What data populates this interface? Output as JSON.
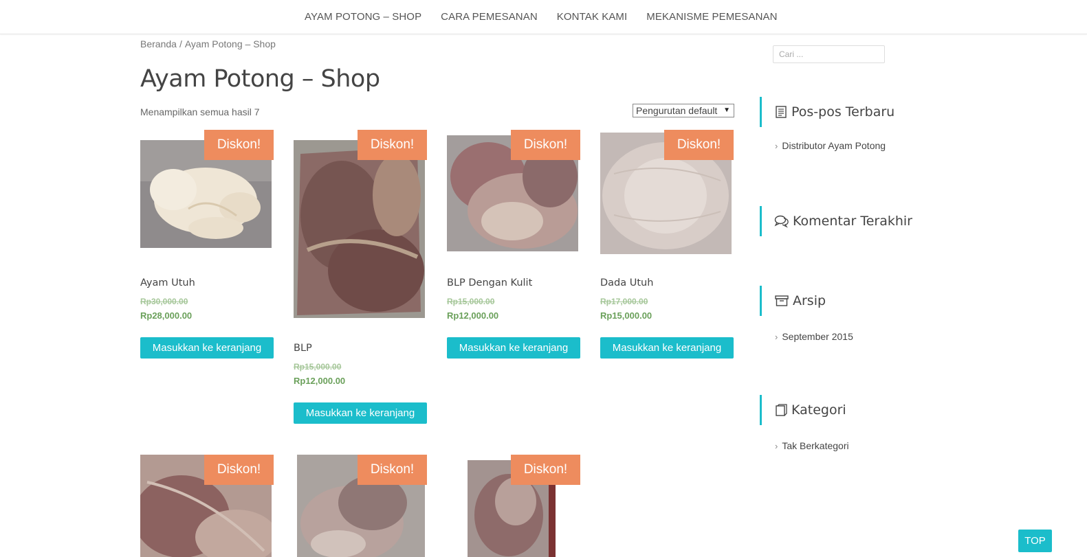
{
  "nav": [
    "AYAM POTONG – SHOP",
    "CARA PEMESANAN",
    "KONTAK KAMI",
    "MEKANISME PEMESANAN"
  ],
  "breadcrumb": {
    "home": "Beranda",
    "sep": "/",
    "current": "Ayam Potong – Shop"
  },
  "page_title": "Ayam Potong – Shop",
  "result_count": "Menampilkan semua hasil 7",
  "sort": {
    "selected": "Pengurutan default",
    "arrow": "▼"
  },
  "badge_label": "Diskon!",
  "add_to_cart": "Masukkan ke keranjang",
  "products": [
    {
      "name": "Ayam Utuh",
      "old_price": "Rp30,000.00",
      "new_price": "Rp28,000.00"
    },
    {
      "name": "BLP",
      "old_price": "Rp15,000.00",
      "new_price": "Rp12,000.00"
    },
    {
      "name": "BLP Dengan Kulit",
      "old_price": "Rp15,000.00",
      "new_price": "Rp12,000.00"
    },
    {
      "name": "Dada Utuh",
      "old_price": "Rp17,000.00",
      "new_price": "Rp15,000.00"
    },
    {
      "name": ""
    },
    {
      "name": ""
    },
    {
      "name": ""
    }
  ],
  "sidebar": {
    "search_placeholder": "Cari ...",
    "recent_posts": {
      "title": "Pos-pos Terbaru",
      "items": [
        "Distributor Ayam Potong"
      ],
      "icon": "document-icon"
    },
    "recent_comments": {
      "title": "Komentar Terakhir",
      "icon": "comments-icon"
    },
    "archives": {
      "title": "Arsip",
      "items": [
        "September 2015"
      ],
      "icon": "archive-icon"
    },
    "categories": {
      "title": "Kategori",
      "items": [
        "Tak Berkategori"
      ],
      "icon": "book-icon"
    }
  },
  "chevron": "›",
  "top_button": "TOP",
  "colors": {
    "accent": "#1bbdcb",
    "badge": "#ee8c5e",
    "price": "#6aa05a"
  }
}
